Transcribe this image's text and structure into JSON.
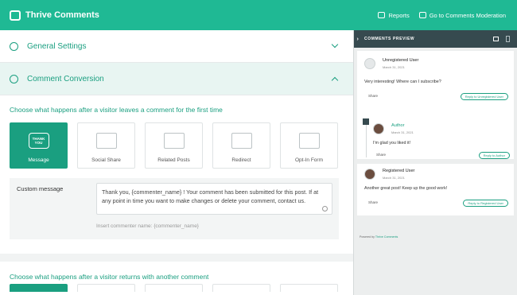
{
  "topbar": {
    "brand": "Thrive Comments",
    "reports": "Reports",
    "moderation": "Go to Comments Moderation"
  },
  "sections": [
    {
      "label": "General Settings",
      "expanded": false
    },
    {
      "label": "Comment Conversion",
      "expanded": true
    }
  ],
  "conversion": {
    "question": "Choose what happens after a visitor leaves a comment for the first time",
    "options": [
      {
        "label": "Message",
        "active": true,
        "art_text": "THANK YOU"
      },
      {
        "label": "Social Share",
        "active": false
      },
      {
        "label": "Related Posts",
        "active": false
      },
      {
        "label": "Redirect",
        "active": false
      },
      {
        "label": "Opt-In Form",
        "active": false
      }
    ],
    "custom_message_label": "Custom message",
    "custom_message_value": "Thank you, {commenter_name} ! Your comment has been submitted for this post. If at any point in time you want to make changes or delete your comment, contact us.",
    "insert_hint": "Insert commenter name: {commenter_name}",
    "question2": "Choose what happens after a visitor returns with another comment"
  },
  "preview": {
    "title": "COMMENTS PREVIEW",
    "comments": [
      {
        "user": "Unregistered User",
        "date": "March 31, 2021",
        "text": "Very interesting! Where can I subscribe?",
        "share": "Share",
        "reply": "Reply to Unregistered User"
      },
      {
        "user": "Author",
        "date": "March 31, 2021",
        "text": "I'm glad you liked it!",
        "share": "Share",
        "reply": "Reply to Author"
      },
      {
        "user": "Registered User",
        "date": "March 31, 2021",
        "text": "Another great post! Keep up the good work!",
        "share": "Share",
        "reply": "Reply to Registered User"
      }
    ],
    "powered_prefix": "Powered by",
    "powered_link": "Thrive Comments"
  },
  "colors": {
    "accent": "#1fb994",
    "accent_dark": "#1a9f80",
    "preview_header": "#364a4f"
  },
  "icons": [
    "comments-logo-icon",
    "reports-icon",
    "moderation-icon",
    "gear-icon",
    "conversion-icon",
    "chevron-down-icon",
    "chevron-up-icon",
    "desktop-icon",
    "mobile-icon",
    "pencil-icon"
  ]
}
